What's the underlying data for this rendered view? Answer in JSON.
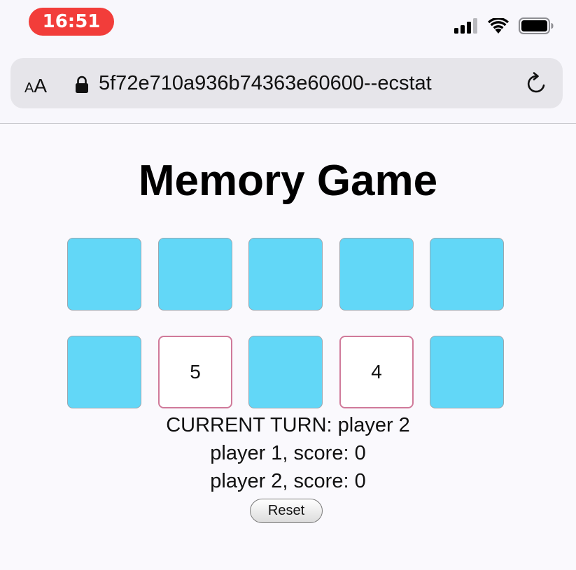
{
  "status_bar": {
    "time": "16:51",
    "icons": [
      "cellular-signal-icon",
      "wifi-icon",
      "battery-icon"
    ]
  },
  "browser": {
    "aa_small": "A",
    "aa_large": "A",
    "url": "5f72e710a936b74363e60600--ecstat",
    "icons": [
      "lock-icon",
      "reload-icon"
    ]
  },
  "game": {
    "title": "Memory Game",
    "cards": [
      {
        "state": "hidden",
        "value": ""
      },
      {
        "state": "hidden",
        "value": ""
      },
      {
        "state": "hidden",
        "value": ""
      },
      {
        "state": "hidden",
        "value": ""
      },
      {
        "state": "hidden",
        "value": ""
      },
      {
        "state": "hidden",
        "value": ""
      },
      {
        "state": "revealed",
        "value": "5"
      },
      {
        "state": "hidden",
        "value": ""
      },
      {
        "state": "revealed",
        "value": "4"
      },
      {
        "state": "hidden",
        "value": ""
      }
    ],
    "current_turn": "CURRENT TURN: player 2",
    "player1_score": "player 1, score: 0",
    "player2_score": "player 2, score: 0",
    "reset_label": "Reset"
  },
  "colors": {
    "hidden_card": "#62d7f7",
    "revealed_border": "#d07a9a",
    "time_pill": "#f23d3a"
  }
}
